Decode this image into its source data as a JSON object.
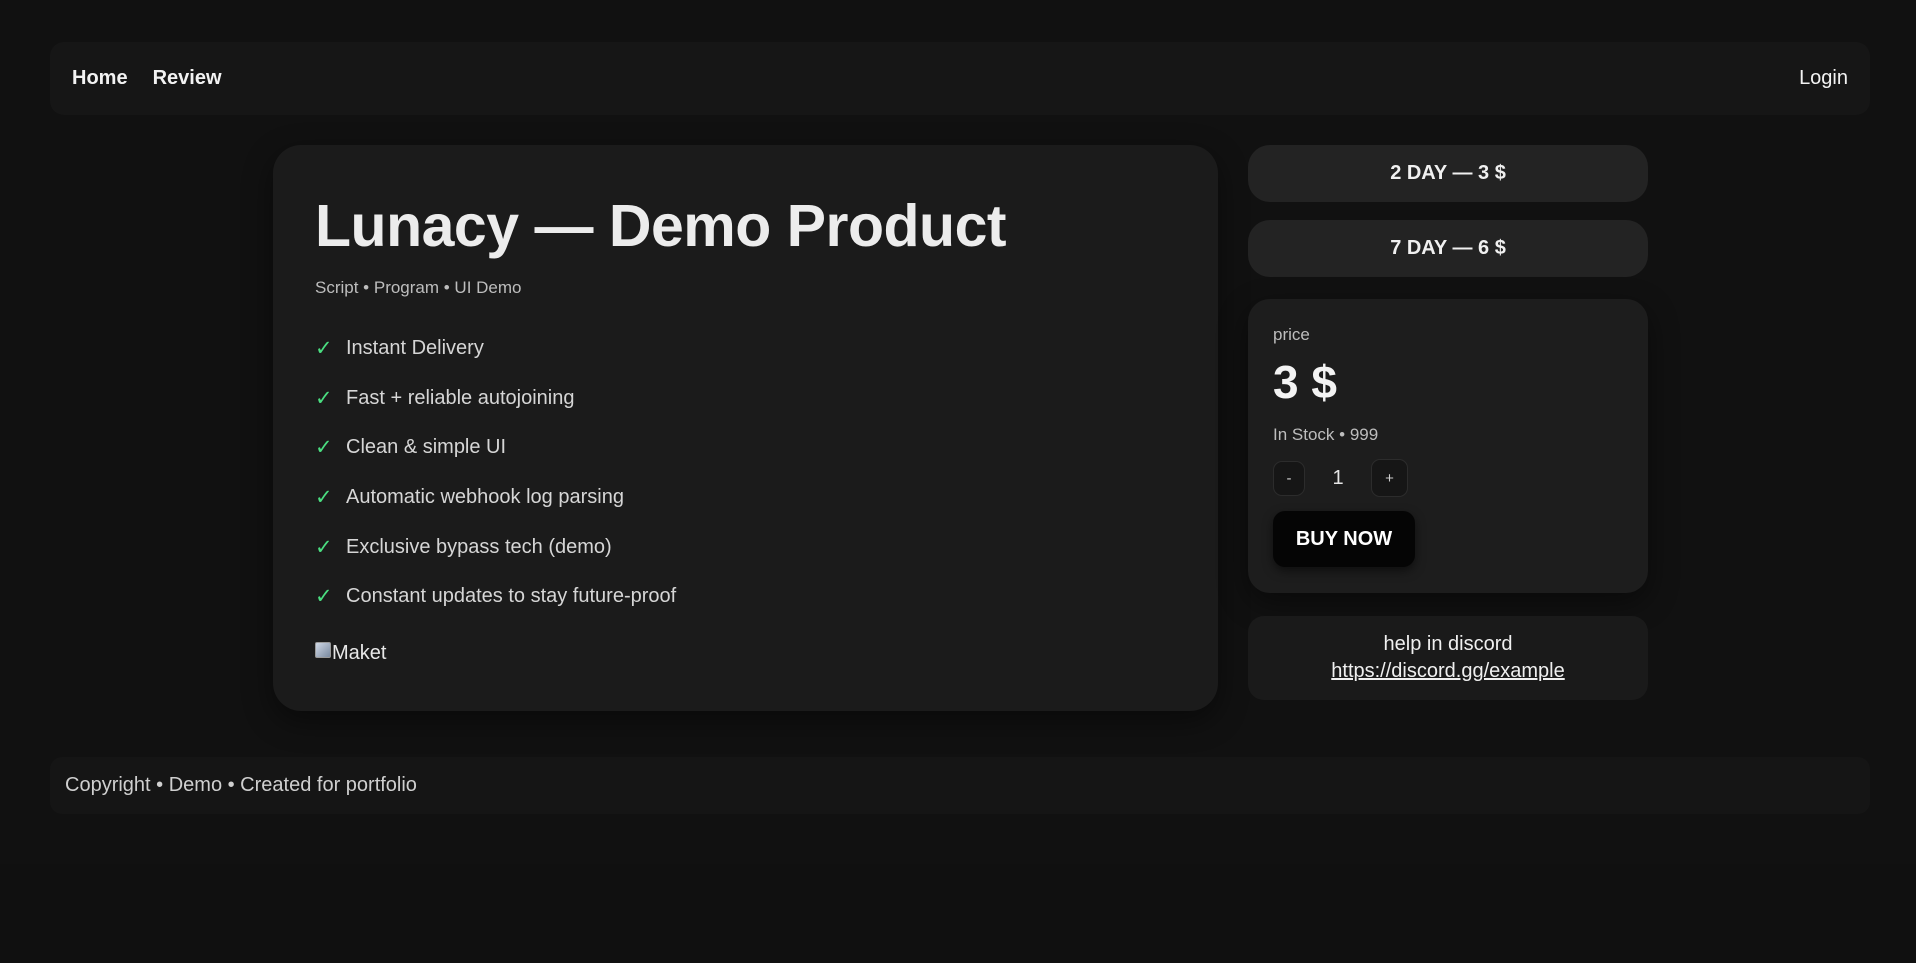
{
  "nav": {
    "links": [
      "Home",
      "Review"
    ],
    "login": "Login"
  },
  "product": {
    "title": "Lunacy — Demo Product",
    "subtitle": "Script • Program • UI Demo",
    "check_glyph": "✓",
    "features": [
      "Instant Delivery",
      "Fast + reliable autojoining",
      "Clean & simple UI",
      "Automatic webhook log parsing",
      "Exclusive bypass tech (demo)",
      "Constant updates to stay future-proof"
    ],
    "image_alt": "Maket"
  },
  "options": {
    "two_day": "2 DAY — 3 $",
    "seven_day": "7 DAY — 6 $"
  },
  "price_card": {
    "label": "price",
    "value": "3 $",
    "stock": "In Stock • 999",
    "minus": "-",
    "quantity": "1",
    "plus": "+",
    "buy": "BUY NOW"
  },
  "help": {
    "text": "help in discord",
    "link": "https://discord.gg/example"
  },
  "footer": {
    "text": "Copyright • Demo • Created for portfolio"
  },
  "colors": {
    "background": "#111111",
    "card": "#1b1b1b",
    "check": "#4ade80",
    "buy_button": "#050505"
  }
}
